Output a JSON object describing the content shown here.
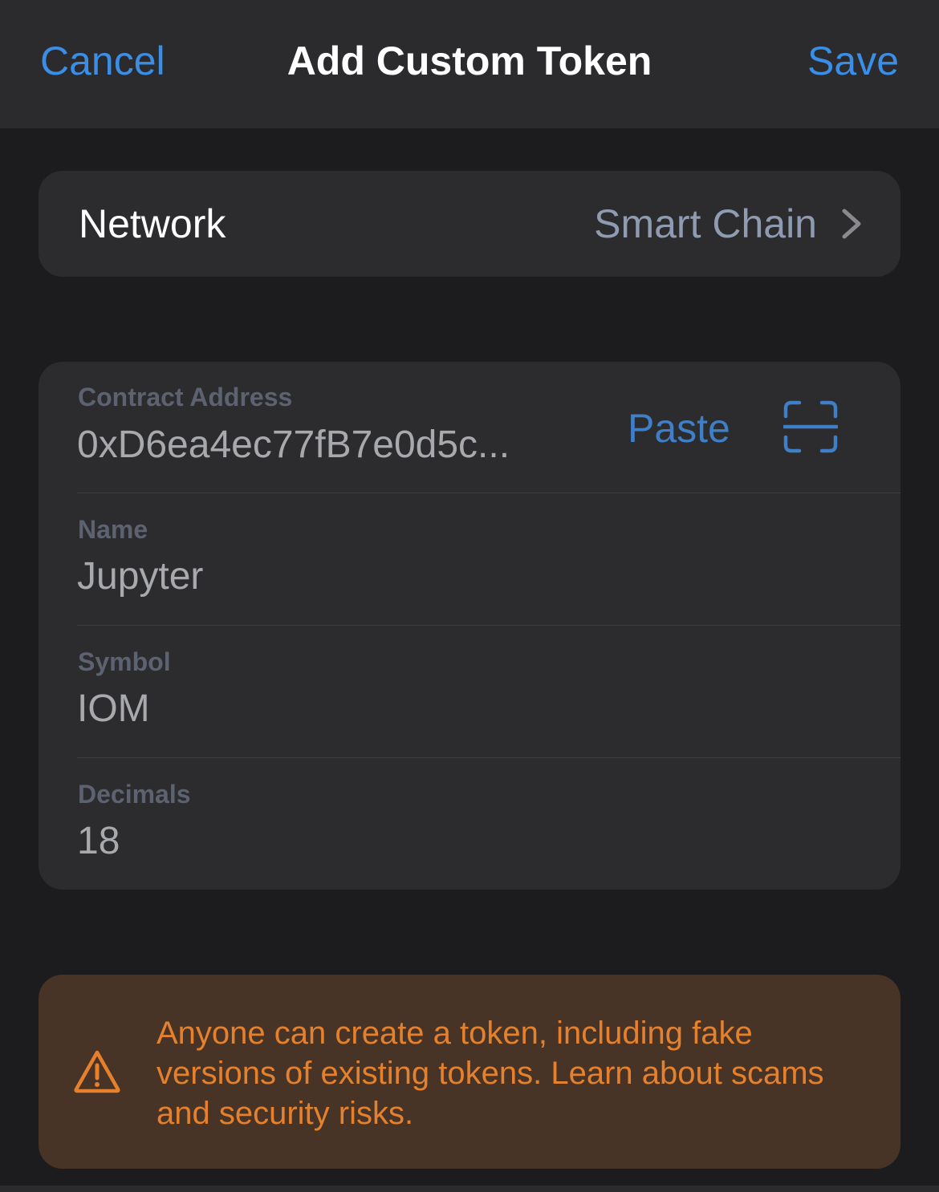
{
  "navbar": {
    "cancel_label": "Cancel",
    "title": "Add Custom Token",
    "save_label": "Save"
  },
  "network": {
    "label": "Network",
    "value": "Smart Chain"
  },
  "form": {
    "contract": {
      "label": "Contract Address",
      "value": "0xD6ea4ec77fB7e0d5c...",
      "paste_label": "Paste"
    },
    "name": {
      "label": "Name",
      "value": "Jupyter"
    },
    "symbol": {
      "label": "Symbol",
      "value": "IOM"
    },
    "decimals": {
      "label": "Decimals",
      "value": "18"
    }
  },
  "warning": {
    "text": "Anyone can create a token, including fake versions of existing tokens. Learn about scams and security risks."
  },
  "icons": {
    "chevron": "chevron-right-icon",
    "scan": "qr-scan-icon",
    "warning": "warning-triangle-icon"
  },
  "colors": {
    "accent": "#3a8ee6",
    "warning_text": "#e5802c",
    "warning_bg": "#473426",
    "card_bg": "#2c2c2e",
    "page_bg": "#1c1c1e"
  }
}
